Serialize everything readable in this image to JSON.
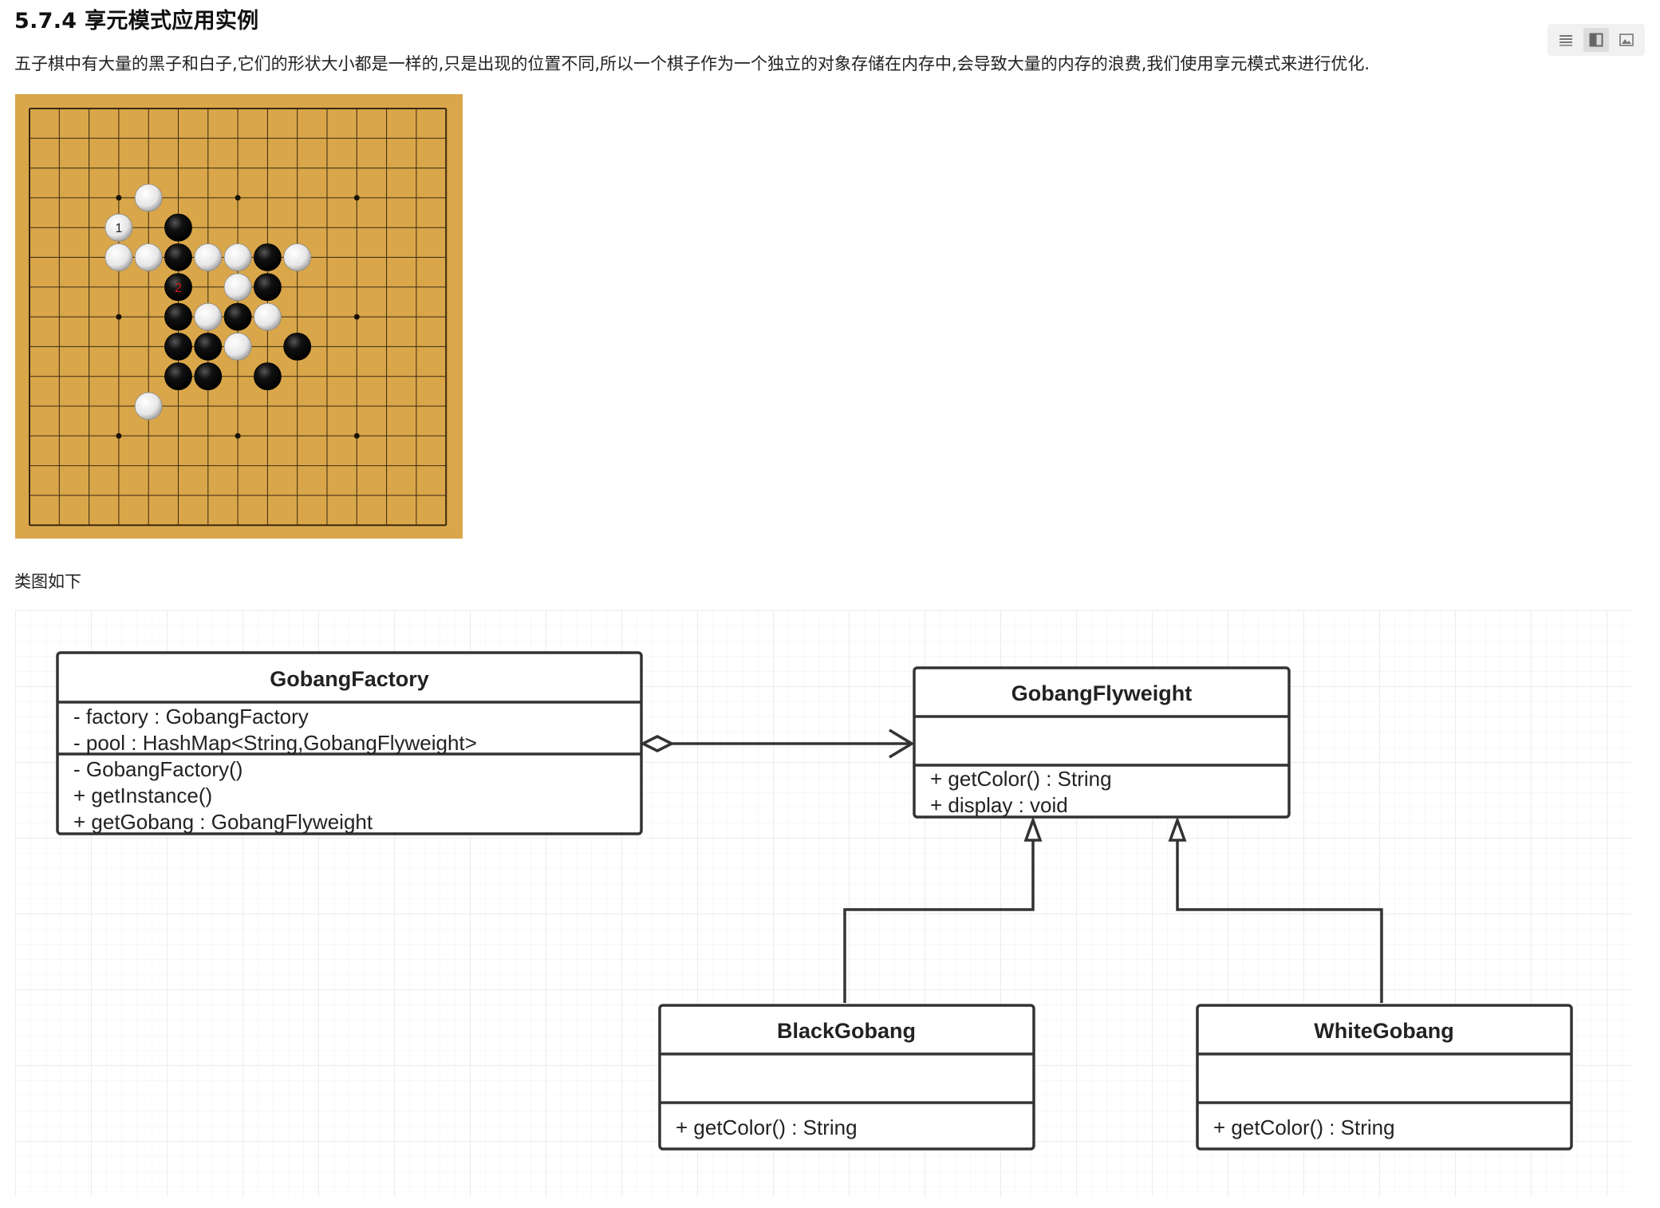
{
  "section": {
    "heading": "5.7.4 享元模式应用实例",
    "paragraph": "五子棋中有大量的黑子和白子,它们的形状大小都是一样的,只是出现的位置不同,所以一个棋子作为一个独立的对象存储在内存中,会导致大量的内存的浪费,我们使用享元模式来进行优化.",
    "caption": "类图如下"
  },
  "toolbar": {
    "buttons": [
      {
        "name": "list-view",
        "icon": "list-icon",
        "active": false
      },
      {
        "name": "split-view",
        "icon": "split-view-icon",
        "active": true
      },
      {
        "name": "image-view",
        "icon": "image-icon",
        "active": false
      }
    ]
  },
  "gobang_board": {
    "lines": 15,
    "board_color": "#d9a64a",
    "stones": [
      {
        "col": 4,
        "row": 3,
        "color": "white"
      },
      {
        "col": 3,
        "row": 4,
        "color": "white",
        "label": "1"
      },
      {
        "col": 5,
        "row": 4,
        "color": "black"
      },
      {
        "col": 3,
        "row": 5,
        "color": "white"
      },
      {
        "col": 4,
        "row": 5,
        "color": "white"
      },
      {
        "col": 5,
        "row": 5,
        "color": "black"
      },
      {
        "col": 6,
        "row": 5,
        "color": "white"
      },
      {
        "col": 7,
        "row": 5,
        "color": "white"
      },
      {
        "col": 8,
        "row": 5,
        "color": "black"
      },
      {
        "col": 9,
        "row": 5,
        "color": "white"
      },
      {
        "col": 5,
        "row": 6,
        "color": "black",
        "label": "2"
      },
      {
        "col": 7,
        "row": 6,
        "color": "white"
      },
      {
        "col": 8,
        "row": 6,
        "color": "black"
      },
      {
        "col": 5,
        "row": 7,
        "color": "black"
      },
      {
        "col": 6,
        "row": 7,
        "color": "white"
      },
      {
        "col": 7,
        "row": 7,
        "color": "black"
      },
      {
        "col": 8,
        "row": 7,
        "color": "white"
      },
      {
        "col": 5,
        "row": 8,
        "color": "black"
      },
      {
        "col": 6,
        "row": 8,
        "color": "black"
      },
      {
        "col": 7,
        "row": 8,
        "color": "white"
      },
      {
        "col": 9,
        "row": 8,
        "color": "black"
      },
      {
        "col": 5,
        "row": 9,
        "color": "black"
      },
      {
        "col": 6,
        "row": 9,
        "color": "black"
      },
      {
        "col": 8,
        "row": 9,
        "color": "black"
      },
      {
        "col": 4,
        "row": 10,
        "color": "white"
      }
    ],
    "star_points": [
      [
        3,
        3
      ],
      [
        7,
        3
      ],
      [
        11,
        3
      ],
      [
        3,
        7
      ],
      [
        11,
        7
      ],
      [
        3,
        11
      ],
      [
        7,
        11
      ],
      [
        11,
        11
      ]
    ]
  },
  "class_diagram": {
    "gobang_factory": {
      "name": "GobangFactory",
      "attributes": [
        "- factory : GobangFactory",
        "- pool : HashMap<String,GobangFlyweight>"
      ],
      "methods": [
        "- GobangFactory()",
        "+ getInstance()",
        "+ getGobang : GobangFlyweight"
      ]
    },
    "gobang_flyweight": {
      "name": "GobangFlyweight",
      "methods": [
        "+ getColor() : String",
        "+ display : void"
      ]
    },
    "black_gobang": {
      "name": "BlackGobang",
      "methods": [
        "+ getColor() : String"
      ]
    },
    "white_gobang": {
      "name": "WhiteGobang",
      "methods": [
        "+ getColor() : String"
      ]
    }
  }
}
